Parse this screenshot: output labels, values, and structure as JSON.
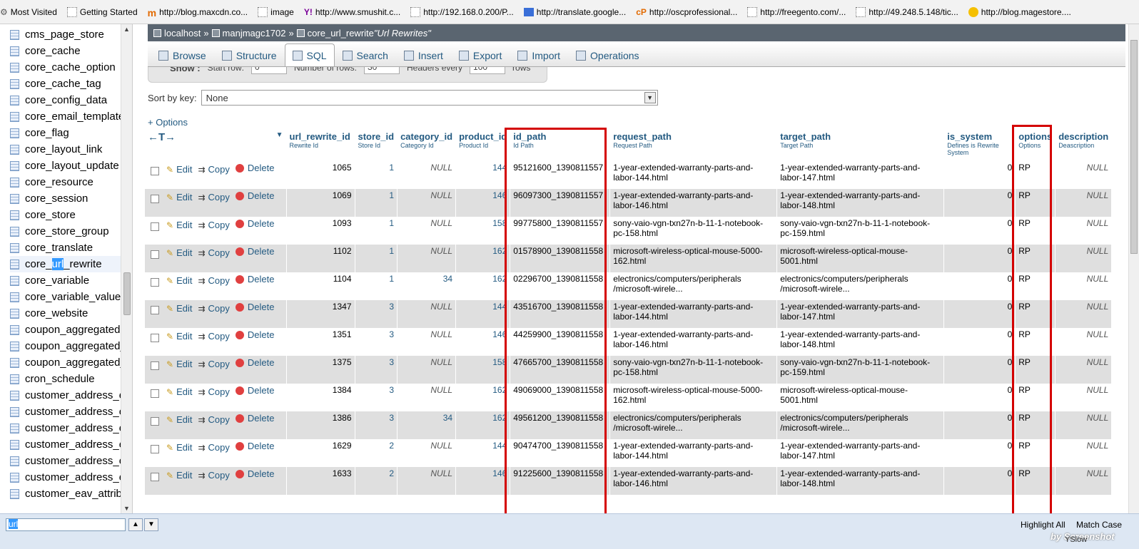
{
  "bookmarks": [
    {
      "label": "Most Visited",
      "icon": "gear-icon"
    },
    {
      "label": "Getting Started",
      "icon": "page-icon"
    },
    {
      "label": "http://blog.maxcdn.co...",
      "icon": "maxcdn-icon"
    },
    {
      "label": "image",
      "icon": "page-icon"
    },
    {
      "label": "http://www.smushit.c...",
      "icon": "yahoo-icon"
    },
    {
      "label": "http://192.168.0.200/P...",
      "icon": "page-icon"
    },
    {
      "label": "http://translate.google...",
      "icon": "translate-icon"
    },
    {
      "label": "http://oscprofessional...",
      "icon": "cpanel-icon"
    },
    {
      "label": "http://freegento.com/...",
      "icon": "page-icon"
    },
    {
      "label": "http://49.248.5.148/tic...",
      "icon": "page-icon"
    },
    {
      "label": "http://blog.magestore....",
      "icon": "magestore-icon"
    }
  ],
  "sidebar": {
    "items": [
      {
        "label": "cms_page_store"
      },
      {
        "label": "core_cache"
      },
      {
        "label": "core_cache_option"
      },
      {
        "label": "core_cache_tag"
      },
      {
        "label": "core_config_data"
      },
      {
        "label": "core_email_template"
      },
      {
        "label": "core_flag"
      },
      {
        "label": "core_layout_link"
      },
      {
        "label": "core_layout_update"
      },
      {
        "label": "core_resource"
      },
      {
        "label": "core_session"
      },
      {
        "label": "core_store"
      },
      {
        "label": "core_store_group"
      },
      {
        "label": "core_translate"
      },
      {
        "label": "core_url_rewrite",
        "pre": "core_",
        "match": "url",
        "post": "_rewrite"
      },
      {
        "label": "core_variable"
      },
      {
        "label": "core_variable_value"
      },
      {
        "label": "core_website"
      },
      {
        "label": "coupon_aggregated"
      },
      {
        "label": "coupon_aggregated_"
      },
      {
        "label": "coupon_aggregated_"
      },
      {
        "label": "cron_schedule"
      },
      {
        "label": "customer_address_e"
      },
      {
        "label": "customer_address_e"
      },
      {
        "label": "customer_address_e"
      },
      {
        "label": "customer_address_e"
      },
      {
        "label": "customer_address_e"
      },
      {
        "label": "customer_address_e"
      },
      {
        "label": "customer_eav_attribu"
      }
    ]
  },
  "breadcrumb": {
    "server": "localhost",
    "database": "manjmagc1702",
    "table": "core_url_rewrite",
    "comment": "\"Url Rewrites\"",
    "sep": "»"
  },
  "tabs": [
    {
      "label": "Browse",
      "icon": "browse-icon"
    },
    {
      "label": "Structure",
      "icon": "structure-icon"
    },
    {
      "label": "SQL",
      "icon": "sql-icon"
    },
    {
      "label": "Search",
      "icon": "search-icon"
    },
    {
      "label": "Insert",
      "icon": "insert-icon"
    },
    {
      "label": "Export",
      "icon": "export-icon"
    },
    {
      "label": "Import",
      "icon": "import-icon"
    },
    {
      "label": "Operations",
      "icon": "operations-icon"
    }
  ],
  "show_row": {
    "show_label": "Show :",
    "start_label": "Start row:",
    "start_value": "0",
    "num_label": "Number of rows:",
    "num_value": "30",
    "headers_label": "Headers every",
    "headers_value": "100",
    "rows_label": "rows"
  },
  "sort": {
    "label": "Sort by key:",
    "value": "None"
  },
  "options_link": "+ Options",
  "actions": {
    "edit": "Edit",
    "copy": "Copy",
    "delete": "Delete"
  },
  "columns": [
    {
      "name": "url_rewrite_id",
      "comment": "Rewrite Id"
    },
    {
      "name": "store_id",
      "comment": "Store Id"
    },
    {
      "name": "category_id",
      "comment": "Category Id"
    },
    {
      "name": "product_id",
      "comment": "Product Id"
    },
    {
      "name": "id_path",
      "comment": "Id Path"
    },
    {
      "name": "request_path",
      "comment": "Request Path"
    },
    {
      "name": "target_path",
      "comment": "Target Path"
    },
    {
      "name": "is_system",
      "comment": "Defines is Rewrite System"
    },
    {
      "name": "options",
      "comment": "Options"
    },
    {
      "name": "description",
      "comment": "Deascription"
    }
  ],
  "rows": [
    {
      "id": "1065",
      "store": "1",
      "cat": "NULL",
      "prod": "144",
      "id_path": "95121600_1390811557",
      "req": "1-year-extended-warranty-parts-and-labor-144.html",
      "target": "1-year-extended-warranty-parts-and-labor-147.html",
      "sys": "0",
      "opt": "RP",
      "desc": "NULL"
    },
    {
      "id": "1069",
      "store": "1",
      "cat": "NULL",
      "prod": "146",
      "id_path": "96097300_1390811557",
      "req": "1-year-extended-warranty-parts-and-labor-146.html",
      "target": "1-year-extended-warranty-parts-and-labor-148.html",
      "sys": "0",
      "opt": "RP",
      "desc": "NULL"
    },
    {
      "id": "1093",
      "store": "1",
      "cat": "NULL",
      "prod": "158",
      "id_path": "99775800_1390811557",
      "req": "sony-vaio-vgn-txn27n-b-11-1-notebook-pc-158.html",
      "target": "sony-vaio-vgn-txn27n-b-11-1-notebook-pc-159.html",
      "sys": "0",
      "opt": "RP",
      "desc": "NULL"
    },
    {
      "id": "1102",
      "store": "1",
      "cat": "NULL",
      "prod": "162",
      "id_path": "01578900_1390811558",
      "req": "microsoft-wireless-optical-mouse-5000-162.html",
      "target": "microsoft-wireless-optical-mouse-5001.html",
      "sys": "0",
      "opt": "RP",
      "desc": "NULL"
    },
    {
      "id": "1104",
      "store": "1",
      "cat": "34",
      "prod": "162",
      "id_path": "02296700_1390811558",
      "req": "electronics/computers/peripherals /microsoft-wirele...",
      "target": "electronics/computers/peripherals /microsoft-wirele...",
      "sys": "0",
      "opt": "RP",
      "desc": "NULL"
    },
    {
      "id": "1347",
      "store": "3",
      "cat": "NULL",
      "prod": "144",
      "id_path": "43516700_1390811558",
      "req": "1-year-extended-warranty-parts-and-labor-144.html",
      "target": "1-year-extended-warranty-parts-and-labor-147.html",
      "sys": "0",
      "opt": "RP",
      "desc": "NULL"
    },
    {
      "id": "1351",
      "store": "3",
      "cat": "NULL",
      "prod": "146",
      "id_path": "44259900_1390811558",
      "req": "1-year-extended-warranty-parts-and-labor-146.html",
      "target": "1-year-extended-warranty-parts-and-labor-148.html",
      "sys": "0",
      "opt": "RP",
      "desc": "NULL"
    },
    {
      "id": "1375",
      "store": "3",
      "cat": "NULL",
      "prod": "158",
      "id_path": "47665700_1390811558",
      "req": "sony-vaio-vgn-txn27n-b-11-1-notebook-pc-158.html",
      "target": "sony-vaio-vgn-txn27n-b-11-1-notebook-pc-159.html",
      "sys": "0",
      "opt": "RP",
      "desc": "NULL"
    },
    {
      "id": "1384",
      "store": "3",
      "cat": "NULL",
      "prod": "162",
      "id_path": "49069000_1390811558",
      "req": "microsoft-wireless-optical-mouse-5000-162.html",
      "target": "microsoft-wireless-optical-mouse-5001.html",
      "sys": "0",
      "opt": "RP",
      "desc": "NULL"
    },
    {
      "id": "1386",
      "store": "3",
      "cat": "34",
      "prod": "162",
      "id_path": "49561200_1390811558",
      "req": "electronics/computers/peripherals /microsoft-wirele...",
      "target": "electronics/computers/peripherals /microsoft-wirele...",
      "sys": "0",
      "opt": "RP",
      "desc": "NULL"
    },
    {
      "id": "1629",
      "store": "2",
      "cat": "NULL",
      "prod": "144",
      "id_path": "90474700_1390811558",
      "req": "1-year-extended-warranty-parts-and-labor-144.html",
      "target": "1-year-extended-warranty-parts-and-labor-147.html",
      "sys": "0",
      "opt": "RP",
      "desc": "NULL"
    },
    {
      "id": "1633",
      "store": "2",
      "cat": "NULL",
      "prod": "146",
      "id_path": "91225600_1390811558",
      "req": "1-year-extended-warranty-parts-and-labor-146.html",
      "target": "1-year-extended-warranty-parts-and-labor-148.html",
      "sys": "0",
      "opt": "RP",
      "desc": "NULL"
    }
  ],
  "findbar": {
    "query": "url",
    "highlight_all": "Highlight All",
    "match_case": "Match Case",
    "yslow": "YSlow",
    "watermark": "by Screenshot"
  },
  "colors": {
    "link": "#235a81",
    "highlight_box": "#d40000",
    "row_alt": "#dfdfdf",
    "breadcrumb_bg": "#5a6570"
  }
}
